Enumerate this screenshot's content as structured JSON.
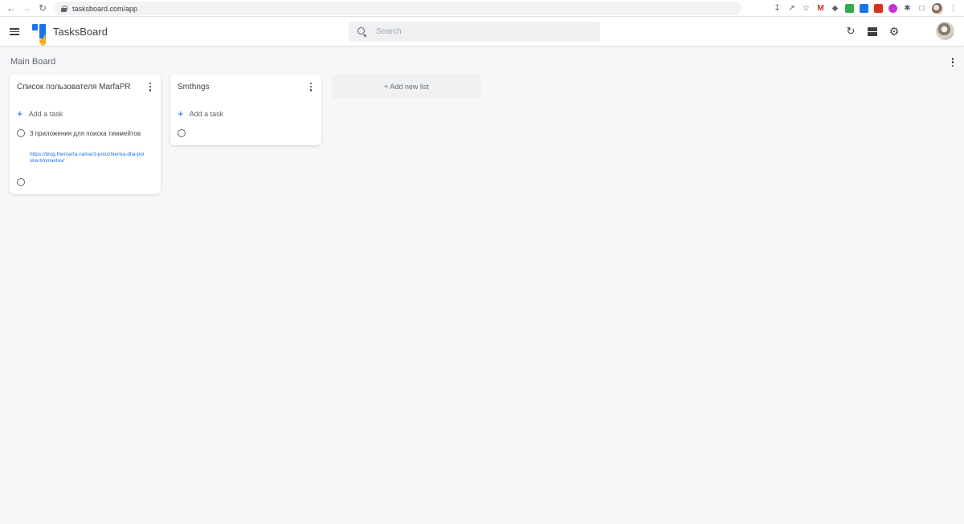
{
  "browser": {
    "url": "tasksboard.com/app"
  },
  "header": {
    "app_name": "TasksBoard",
    "search_placeholder": "Search"
  },
  "board": {
    "title": "Main Board",
    "lists": [
      {
        "title": "Список пользователя MarfaPR",
        "add_task_label": "Add a task",
        "tasks": [
          {
            "title": "3 приложения для поиска тиммейтов",
            "link": "https://blog.themarfa.name/3-polozhieniia-dlia-poiska-timmieitov/"
          }
        ]
      },
      {
        "title": "Smthngs",
        "add_task_label": "Add a task"
      }
    ],
    "add_list_label": "+ Add new list"
  },
  "colors": {
    "accent": "#1a73e8",
    "background": "#f6f7f9"
  }
}
